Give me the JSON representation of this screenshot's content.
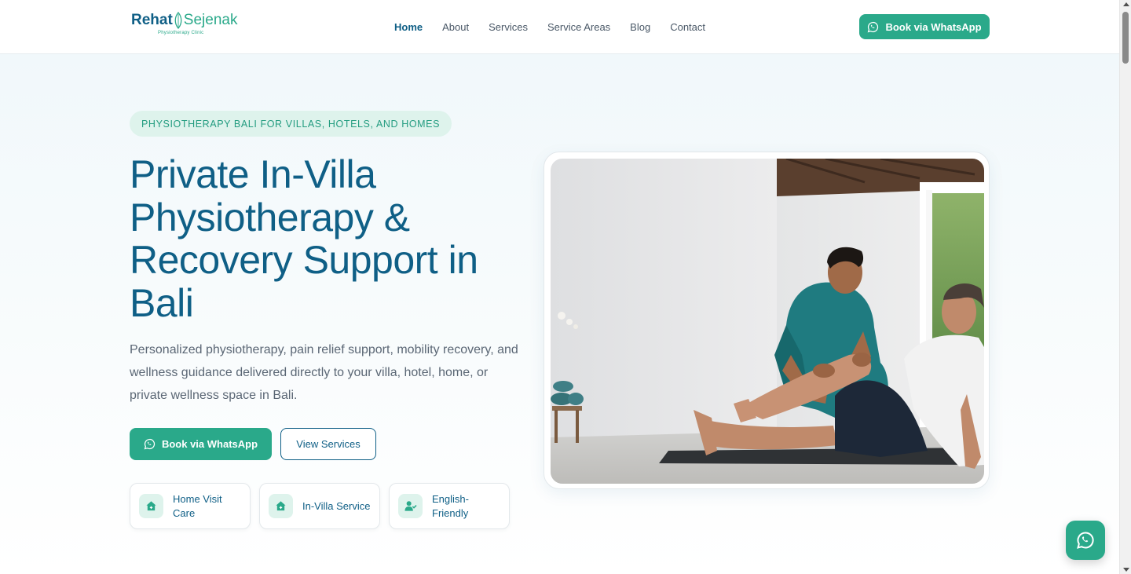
{
  "header": {
    "logo_part1": "Rehat",
    "logo_part2": "Sejenak",
    "logo_tagline": "Physiotherapy Clinic",
    "nav": [
      {
        "label": "Home",
        "active": true
      },
      {
        "label": "About"
      },
      {
        "label": "Services"
      },
      {
        "label": "Service Areas"
      },
      {
        "label": "Blog"
      },
      {
        "label": "Contact"
      }
    ],
    "cta_label": "Book via WhatsApp",
    "cta_icon": "whatsapp-icon"
  },
  "hero": {
    "eyebrow": "PHYSIOTHERAPY BALI FOR VILLAS, HOTELS, AND HOMES",
    "title": "Private In-Villa Physiotherapy & Recovery Support in Bali",
    "description": "Personalized physiotherapy, pain relief support, mobility recovery, and wellness guidance delivered directly to your villa, hotel, home, or private wellness space in Bali.",
    "primary_button": "Book via WhatsApp",
    "secondary_button": "View Services",
    "features": [
      {
        "label": "Home Visit Care",
        "icon": "home-icon"
      },
      {
        "label": "In-Villa Service",
        "icon": "home-plus-icon"
      },
      {
        "label": "English-Friendly",
        "icon": "user-check-icon"
      }
    ],
    "image_icon": "physiotherapy-session-photo"
  },
  "floating_button": {
    "icon": "whatsapp-icon"
  },
  "colors": {
    "brand_primary": "#0f5f86",
    "brand_accent": "#2aa98a",
    "accent_soft": "#def3ec"
  }
}
